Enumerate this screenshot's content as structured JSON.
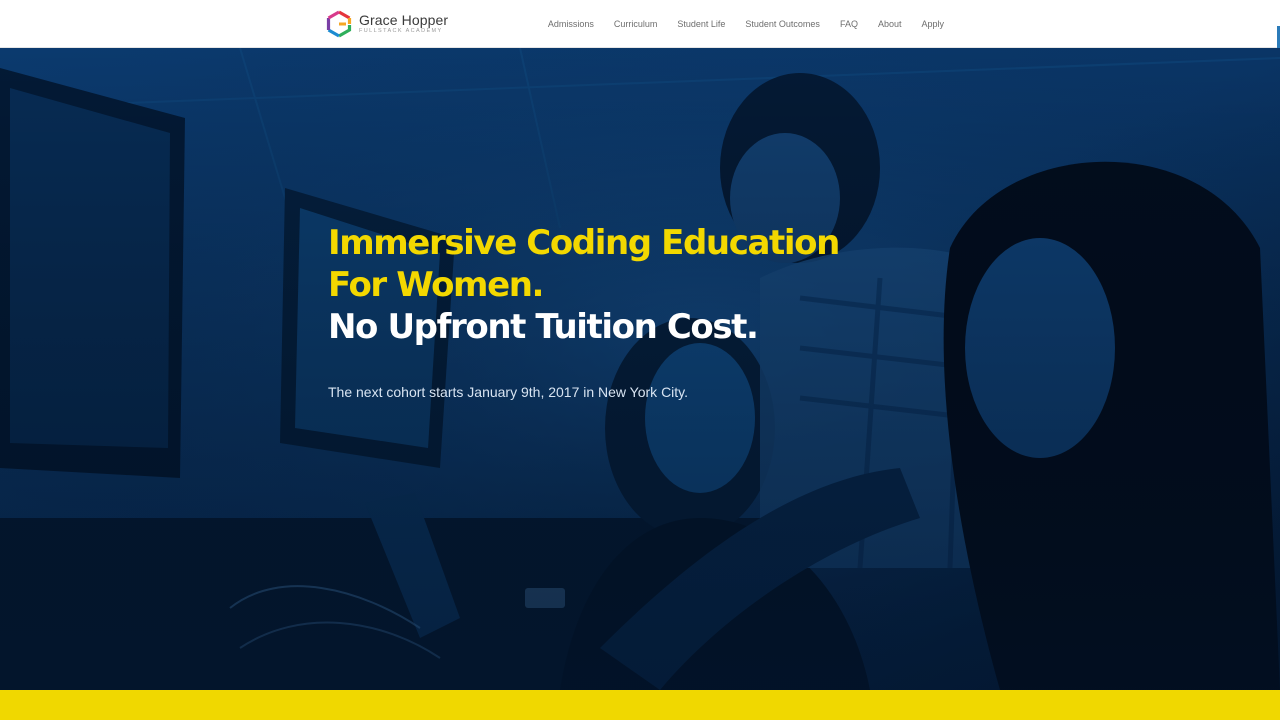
{
  "brand": {
    "name": "Grace Hopper",
    "subtitle": "FULLSTACK ACADEMY",
    "logo_colors": [
      "#e5353c",
      "#f5a623",
      "#2eaf5b",
      "#1b8bd1",
      "#7a3fa6"
    ]
  },
  "nav": {
    "items": [
      {
        "label": "Admissions"
      },
      {
        "label": "Curriculum"
      },
      {
        "label": "Student Life"
      },
      {
        "label": "Student Outcomes"
      },
      {
        "label": "FAQ"
      },
      {
        "label": "About"
      },
      {
        "label": "Apply"
      }
    ]
  },
  "hero": {
    "headline_line1": "Immersive Coding Education",
    "headline_line2": "For Women.",
    "headline_line3": "No Upfront Tuition Cost.",
    "subtext": "The next cohort starts January 9th, 2017 in New York City.",
    "accent_color": "#f3d800",
    "overlay_color": "#0a3d73"
  },
  "footer_band": {
    "color": "#f0d800"
  }
}
